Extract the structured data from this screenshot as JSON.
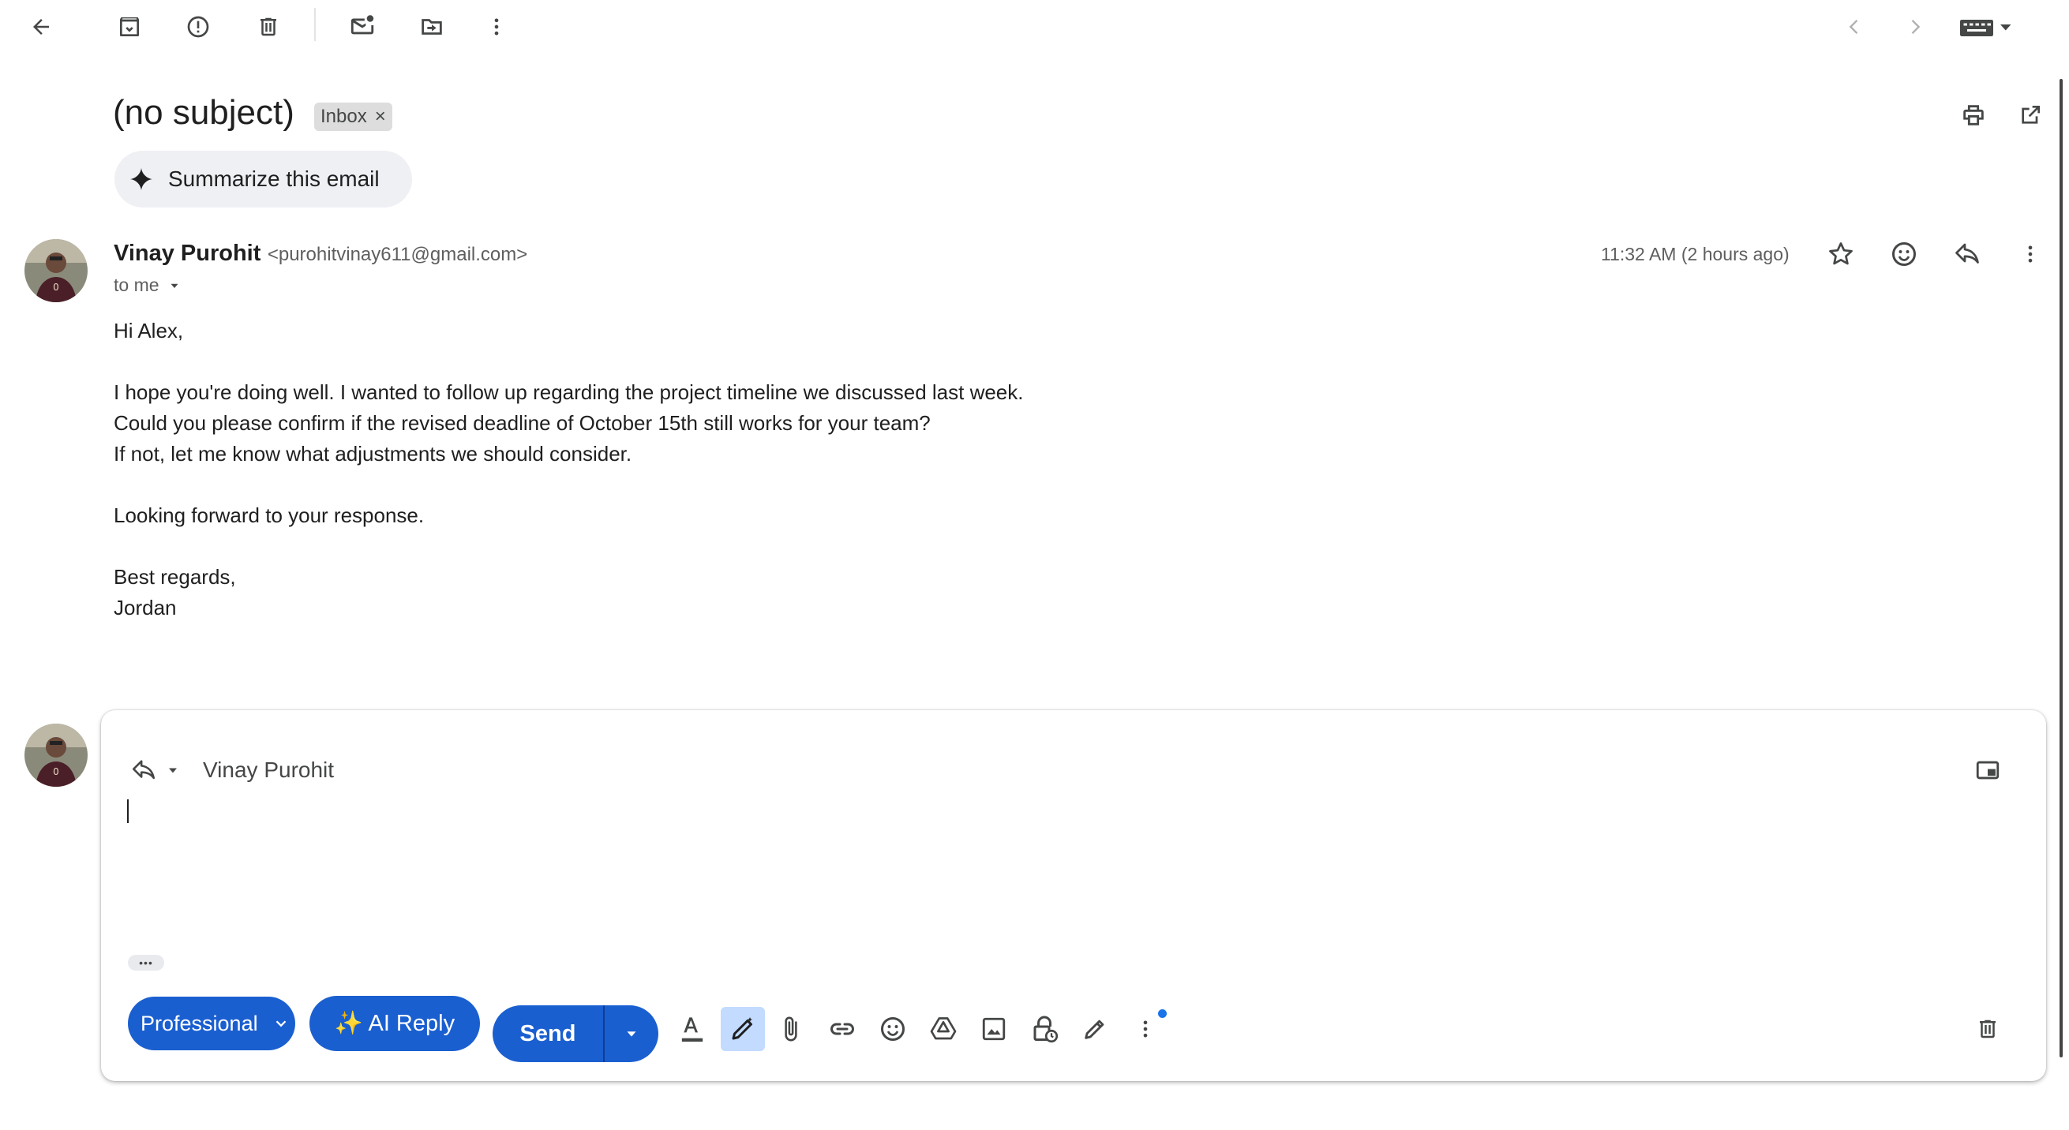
{
  "toolbar": {
    "icons": [
      "back-arrow-icon",
      "archive-icon",
      "report-spam-icon",
      "delete-icon",
      "mark-unread-icon",
      "move-to-icon",
      "more-vert-icon"
    ],
    "nav_icons": [
      "chevron-left-icon",
      "chevron-right-icon",
      "keyboard-icon"
    ]
  },
  "email": {
    "subject": "(no subject)",
    "label": "Inbox",
    "label_remove": "×",
    "summarize_label": "Summarize this email",
    "sender_name": "Vinay Purohit",
    "sender_email": "<purohitvinay611@gmail.com>",
    "recipient": "to me",
    "timestamp": "11:32 AM (2 hours ago)",
    "body": {
      "greeting": "Hi Alex,",
      "line1": "I hope you're doing well. I wanted to follow up regarding the project timeline we discussed last week.",
      "line2": "Could you please confirm if the revised deadline of October 15th still works for your team?",
      "line3": "If not, let me know what adjustments we should consider.",
      "line4": "Looking forward to your response.",
      "closing": "Best regards,",
      "signature": "Jordan"
    }
  },
  "reply": {
    "recipient": "Vinay Purohit",
    "ellipsis": "•••",
    "tone_label": "Professional",
    "ai_reply_label": "✨ AI Reply",
    "send_label": "Send"
  },
  "colors": {
    "accent": "#1a5fd0",
    "chip_bg": "#eef0f4",
    "label_bg": "#dddddd",
    "notification_dot": "#1a73e8"
  }
}
